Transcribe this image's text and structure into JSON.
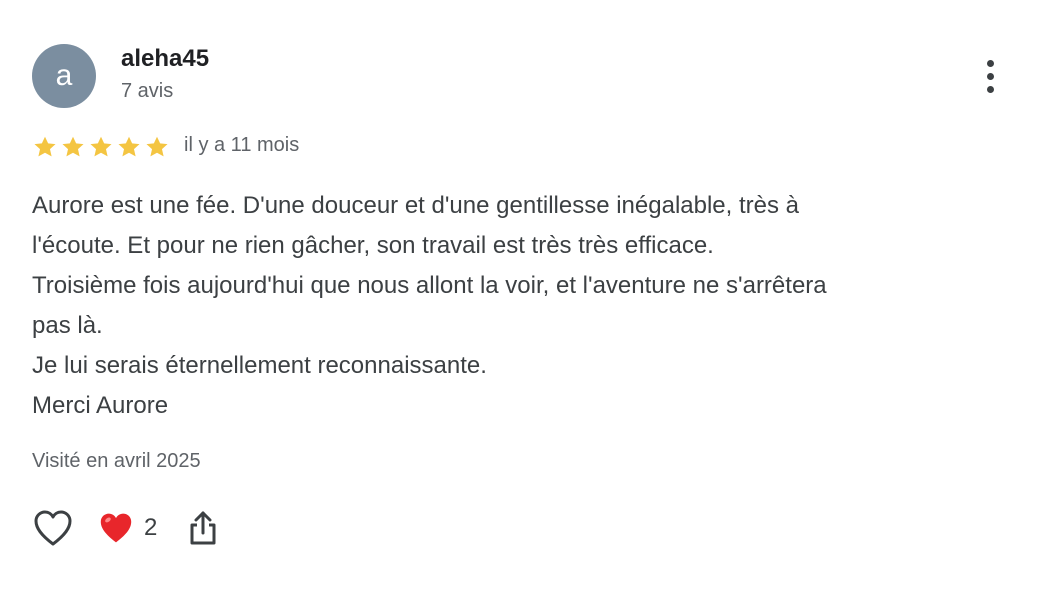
{
  "author": {
    "initial": "a",
    "name": "aleha45",
    "review_count": "7 avis",
    "avatar_color": "#7b8ea0"
  },
  "menu": {
    "icon": "more-vert-icon"
  },
  "rating": {
    "stars": 5,
    "max": 5,
    "star_color": "#f4c542",
    "date": "il y a 11 mois"
  },
  "review": {
    "lines": [
      "Aurore est une fée. D'une douceur et d'une gentillesse inégalable, très à",
      "l'écoute. Et pour ne rien gâcher, son travail est très très efficace.",
      "Troisième fois aujourd'hui que nous allont la voir, et l'aventure ne s'arrêtera",
      "pas là.",
      "Je lui serais éternellement reconnaissante.",
      "Merci Aurore"
    ],
    "visited": "Visité en avril 2025"
  },
  "actions": {
    "like_icon": "heart-outline-icon",
    "reaction_icon": "red-heart-icon",
    "reaction_count": "2",
    "share_icon": "share-icon"
  }
}
